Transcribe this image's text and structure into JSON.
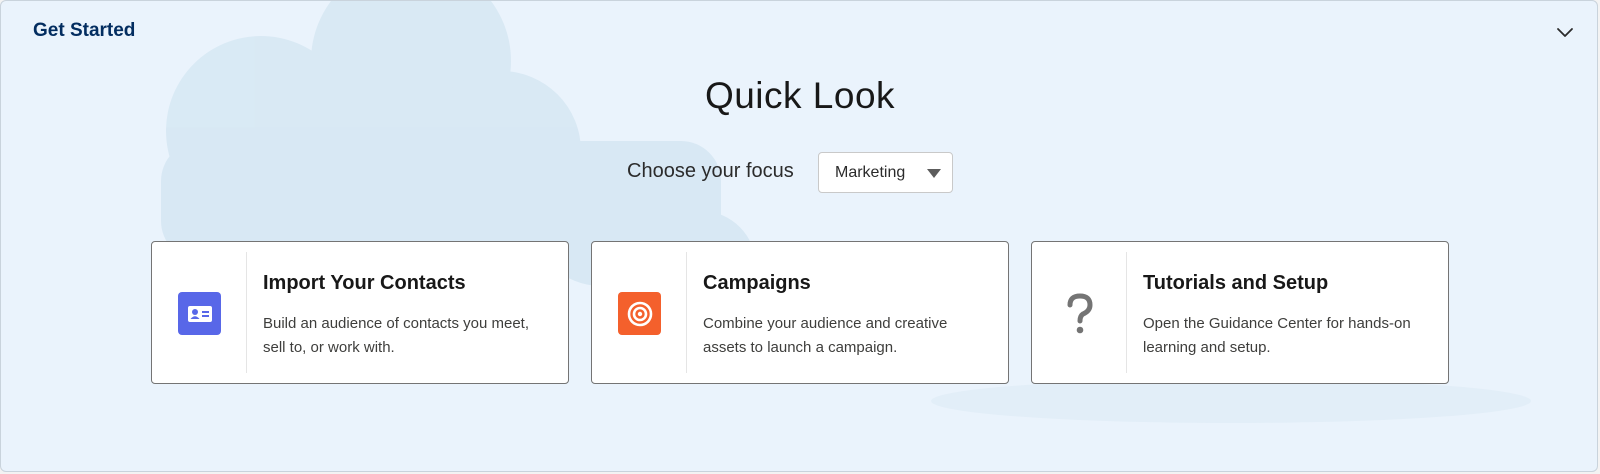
{
  "header": {
    "title": "Get Started",
    "collapse_icon": "chevron-down-icon"
  },
  "main": {
    "title": "Quick Look",
    "focus": {
      "label": "Choose your focus",
      "selected": "Marketing",
      "icon": "caret-down-icon"
    },
    "cards": [
      {
        "title": "Import Your Contacts",
        "description": "Build an audience of contacts you meet, sell to, or work with.",
        "icon": "contact-card-icon",
        "icon_color": "#5867e8"
      },
      {
        "title": "Campaigns",
        "description": "Combine your audience and creative assets to launch a campaign.",
        "icon": "target-icon",
        "icon_color": "#f4602c"
      },
      {
        "title": "Tutorials and Setup",
        "description": "Open the Guidance Center for hands-on learning and setup.",
        "icon": "question-mark-icon",
        "icon_color": "#747474"
      }
    ]
  },
  "colors": {
    "background": "#eaf3fc",
    "header_text": "#032d60",
    "card_border": "#747474"
  }
}
